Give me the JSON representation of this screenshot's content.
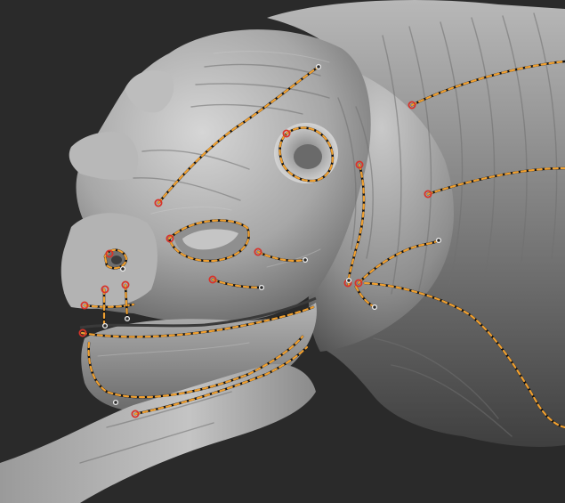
{
  "viewport": {
    "background_color": "#2a2a2a",
    "model_base_color": "#a9a9a9",
    "model_highlight_color": "#d8d8d8",
    "model_shadow_color": "#4a4a4a"
  },
  "curve_style": {
    "stroke_color": "#f0a030",
    "dash_gap_color": "#151515"
  },
  "markers": {
    "red_marker_color": "#d8332a",
    "white_marker_color": "#f2f2f2",
    "red_marker_count": 16,
    "white_marker_count": 10
  }
}
